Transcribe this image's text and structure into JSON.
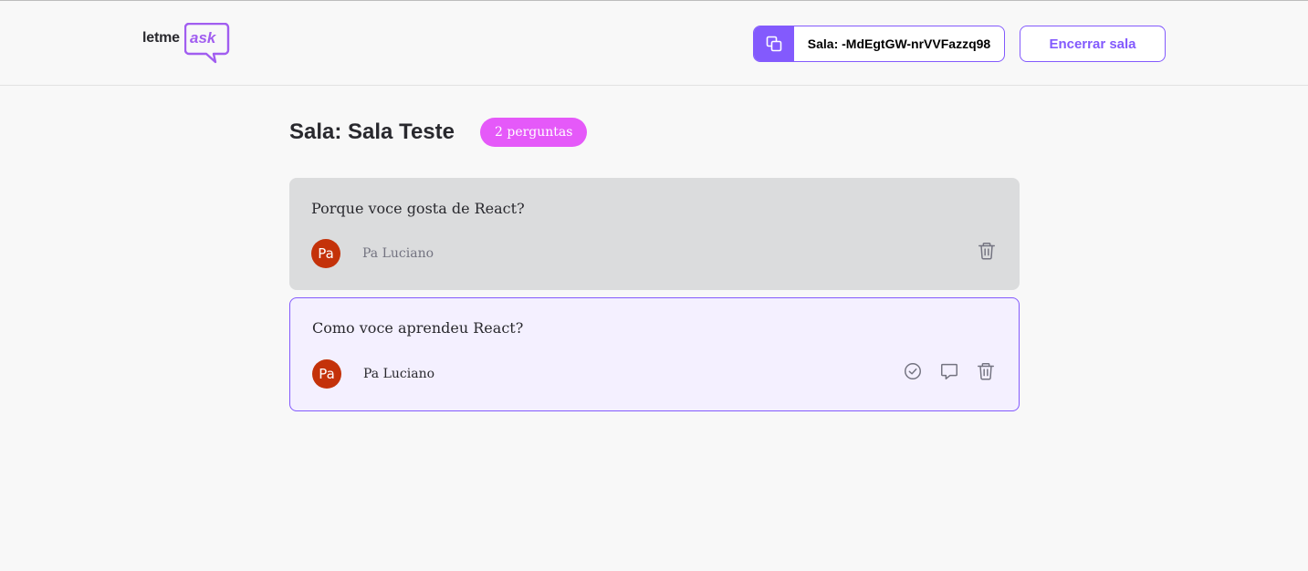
{
  "logo": {
    "part1": "letme",
    "part2": "ask"
  },
  "header": {
    "room_code_label": "Sala: -MdEgtGW-nrVVFazzq98",
    "close_room_label": "Encerrar sala"
  },
  "room": {
    "title": "Sala: Sala Teste",
    "question_count": "2 perguntas"
  },
  "questions": [
    {
      "content": "Porque voce gosta de React?",
      "author": {
        "initials": "Pa",
        "name": "Pa Luciano"
      },
      "actions": [
        "trash-icon"
      ],
      "state": "answered"
    },
    {
      "content": "Como voce aprendeu React?",
      "author": {
        "initials": "Pa",
        "name": "Pa Luciano"
      },
      "actions": [
        "check-circle-icon",
        "chat-bubble-icon",
        "trash-icon"
      ],
      "state": "highlighted"
    }
  ],
  "colors": {
    "accent": "#835afd",
    "badge": "#e559f9",
    "answered_bg": "#dbdcdd",
    "highlighted_bg": "#f4f0ff",
    "avatar": "#c4320a"
  }
}
